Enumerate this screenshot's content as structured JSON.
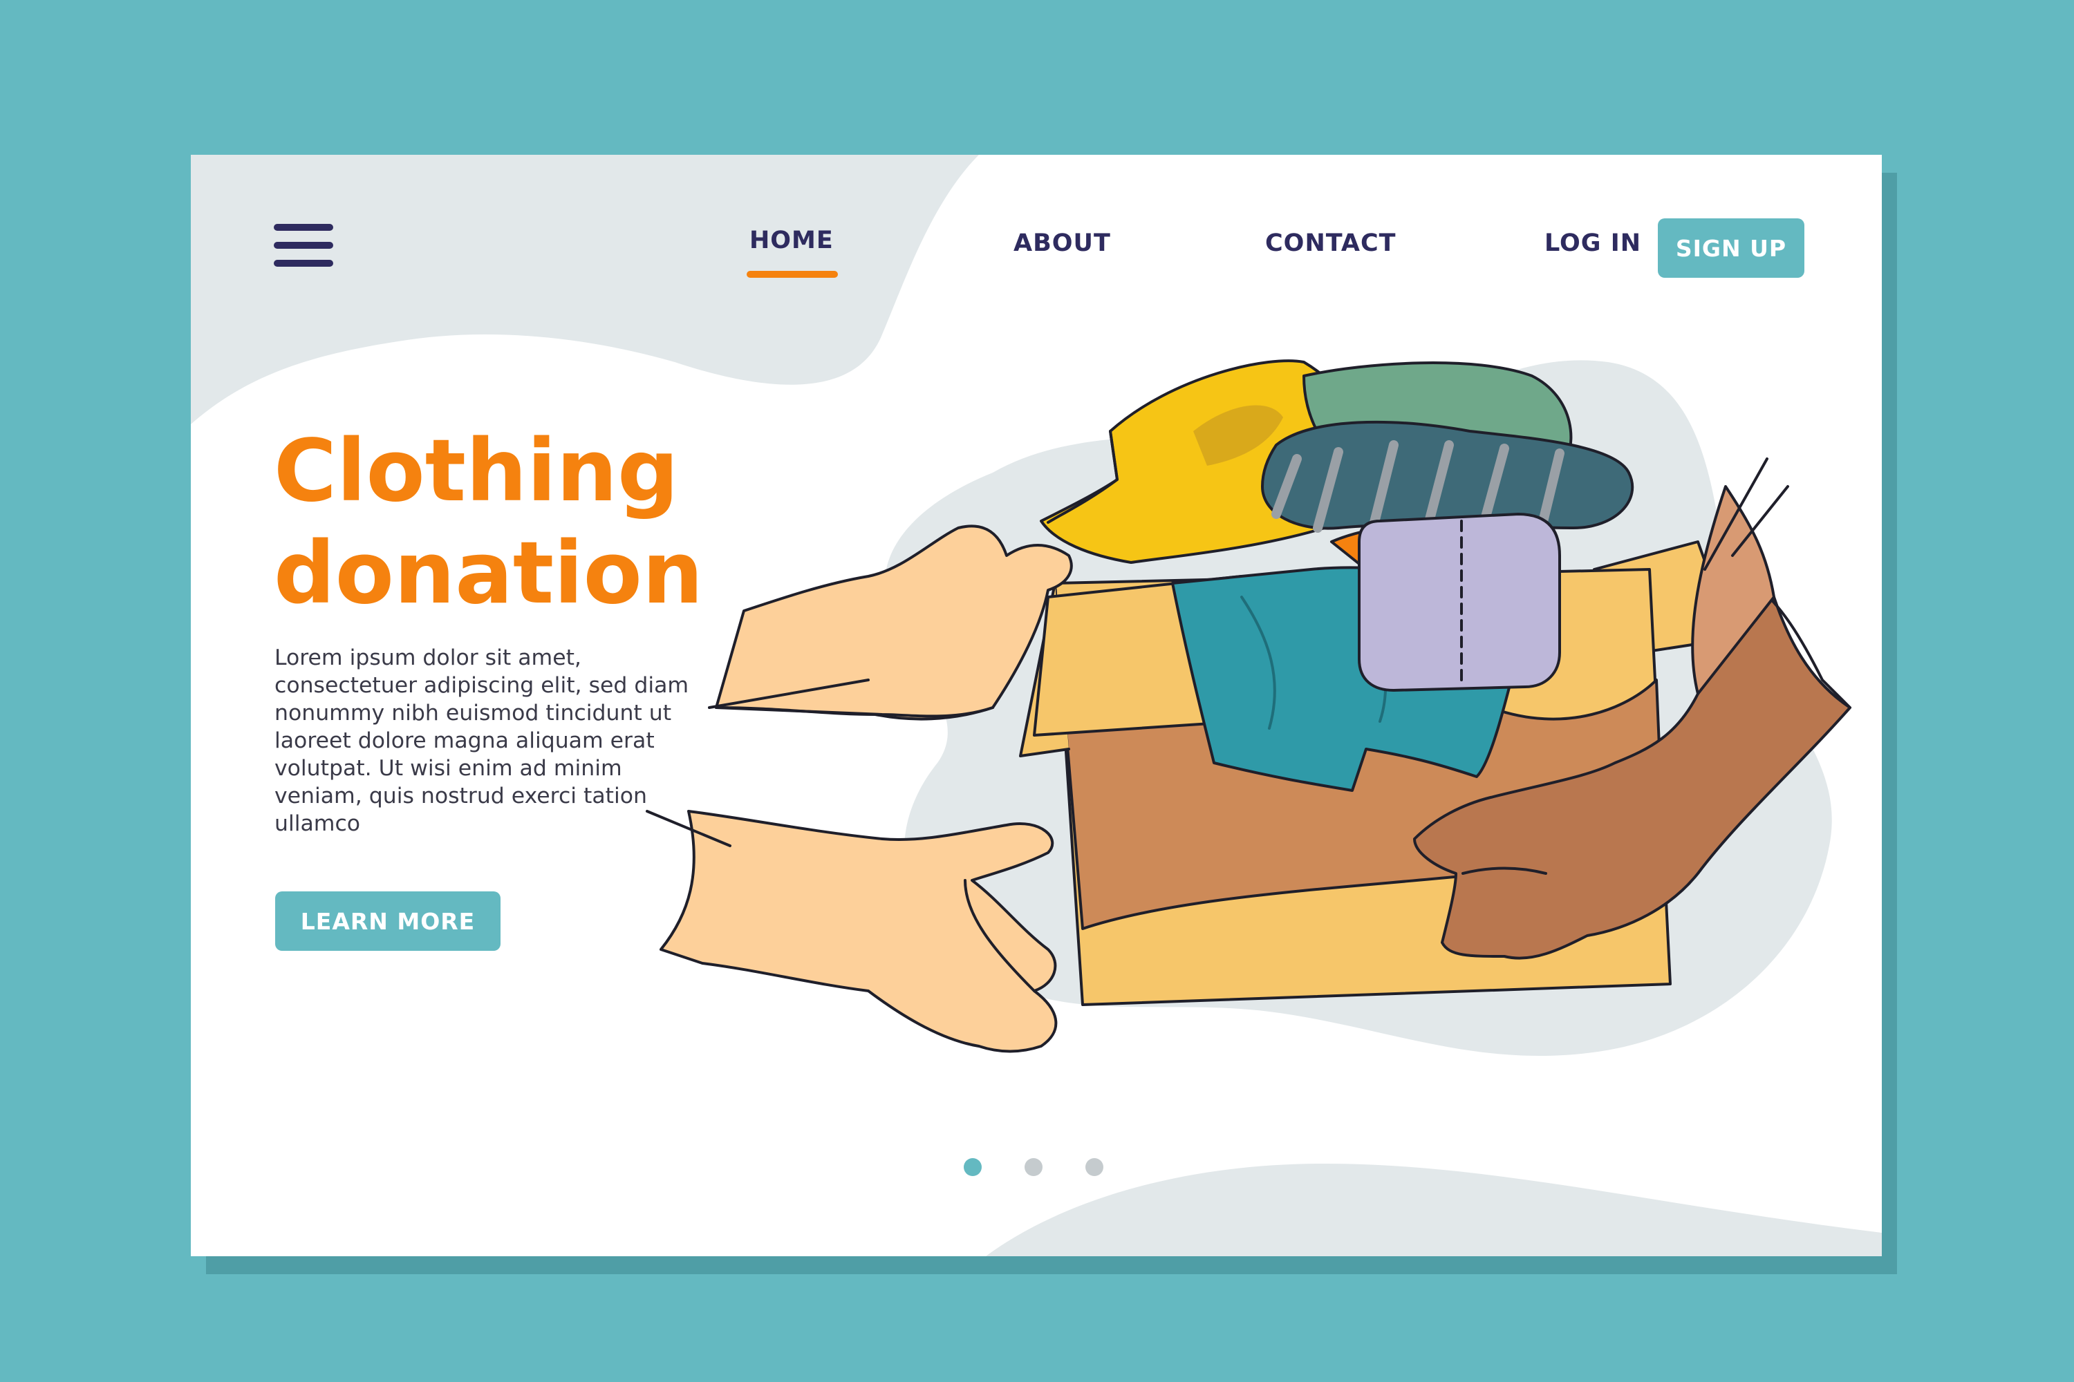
{
  "header": {
    "menu_icon": "hamburger-menu-icon",
    "nav": [
      {
        "label": "HOME",
        "active": true
      },
      {
        "label": "ABOUT",
        "active": false
      },
      {
        "label": "CONTACT",
        "active": false
      }
    ],
    "login_label": "LOG IN",
    "signup_label": "SIGN UP"
  },
  "hero": {
    "title_line1": "Clothing",
    "title_line2": "donation",
    "body": "Lorem ipsum dolor sit amet, consectetuer adipiscing elit, sed diam nonummy nibh euismod tincidunt ut laoreet dolore magna aliquam erat volutpat. Ut wisi enim ad minim veniam, quis nostrud exerci tation ullamco",
    "cta_label": "LEARN MORE"
  },
  "carousel": {
    "count": 3,
    "active_index": 0
  },
  "colors": {
    "outer_bg": "#64b9c1",
    "accent": "#f5820f",
    "nav_text": "#2e2b5f",
    "button": "#64b9c1",
    "blob": "#e2e8ea"
  }
}
